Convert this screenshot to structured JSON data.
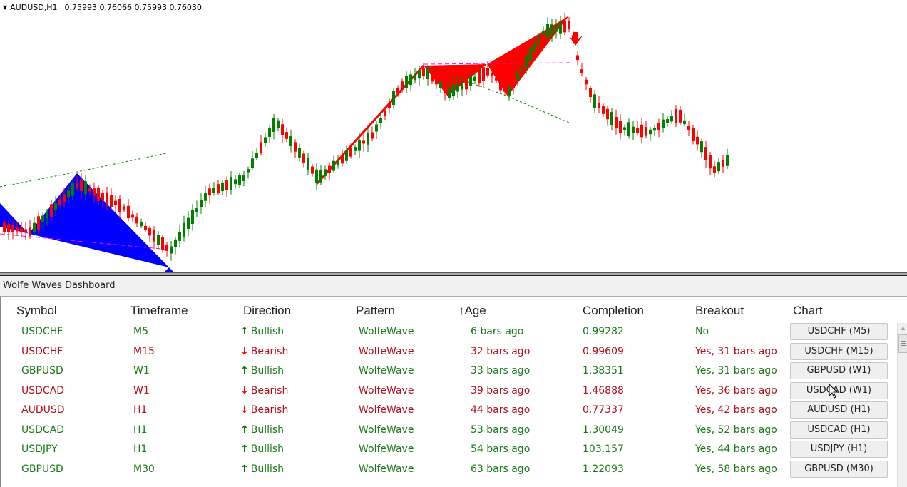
{
  "chart": {
    "symbol_tf": "AUDUSD,H1",
    "ohlc": "0.75993 0.76066 0.75993 0.76030",
    "menu_icon": "triangle-down-icon",
    "bullish_color": "#008000",
    "bearish_color": "#ff0000",
    "bullish_pattern_color": "#0000ff",
    "bearish_pattern_color": "#ff0000",
    "target_line_color": "#008000",
    "level_line_color": "#ff00ff",
    "signal_arrow": "bearish-arrow-down-icon"
  },
  "dashboard": {
    "title": "Wolfe Waves Dashboard",
    "columns": [
      "Symbol",
      "Timeframe",
      "Direction",
      "Pattern",
      "↑Age",
      "Completion",
      "Breakout",
      "Chart"
    ],
    "sort_indicator": "sort-ascending-icon",
    "colors": {
      "bullish": "#1a7a1a",
      "bearish": "#b01020"
    },
    "rows": [
      {
        "symbol": "USDCHF",
        "timeframe": "M5",
        "direction": "Bullish",
        "dir_icon": "↑",
        "pattern": "WolfeWave",
        "age": "6 bars ago",
        "completion": "0.99282",
        "breakout": "No",
        "chart_button": "USDCHF (M5)",
        "type": "bull"
      },
      {
        "symbol": "USDCHF",
        "timeframe": "M15",
        "direction": "Bearish",
        "dir_icon": "↓",
        "pattern": "WolfeWave",
        "age": "32 bars ago",
        "completion": "0.99609",
        "breakout": "Yes, 31 bars ago",
        "chart_button": "USDCHF (M15)",
        "type": "bear"
      },
      {
        "symbol": "GBPUSD",
        "timeframe": "W1",
        "direction": "Bullish",
        "dir_icon": "↑",
        "pattern": "WolfeWave",
        "age": "33 bars ago",
        "completion": "1.38351",
        "breakout": "Yes, 31 bars ago",
        "chart_button": "GBPUSD (W1)",
        "type": "bull"
      },
      {
        "symbol": "USDCAD",
        "timeframe": "W1",
        "direction": "Bearish",
        "dir_icon": "↓",
        "pattern": "WolfeWave",
        "age": "39 bars ago",
        "completion": "1.46888",
        "breakout": "Yes, 36 bars ago",
        "chart_button": "USDCAD (W1)",
        "type": "bear"
      },
      {
        "symbol": "AUDUSD",
        "timeframe": "H1",
        "direction": "Bearish",
        "dir_icon": "↓",
        "pattern": "WolfeWave",
        "age": "44 bars ago",
        "completion": "0.77337",
        "breakout": "Yes, 42 bars ago",
        "chart_button": "AUDUSD (H1)",
        "type": "bear"
      },
      {
        "symbol": "USDCAD",
        "timeframe": "H1",
        "direction": "Bullish",
        "dir_icon": "↑",
        "pattern": "WolfeWave",
        "age": "53 bars ago",
        "completion": "1.30049",
        "breakout": "Yes, 52 bars ago",
        "chart_button": "USDCAD (H1)",
        "type": "bull"
      },
      {
        "symbol": "USDJPY",
        "timeframe": "H1",
        "direction": "Bullish",
        "dir_icon": "↑",
        "pattern": "WolfeWave",
        "age": "54 bars ago",
        "completion": "103.157",
        "breakout": "Yes, 44 bars ago",
        "chart_button": "USDJPY (H1)",
        "type": "bull"
      },
      {
        "symbol": "GBPUSD",
        "timeframe": "M30",
        "direction": "Bullish",
        "dir_icon": "↑",
        "pattern": "WolfeWave",
        "age": "63 bars ago",
        "completion": "1.22093",
        "breakout": "Yes, 58 bars ago",
        "chart_button": "GBPUSD (M30)",
        "type": "bull"
      }
    ],
    "scrollbar": {
      "up_icon": "▲"
    }
  }
}
